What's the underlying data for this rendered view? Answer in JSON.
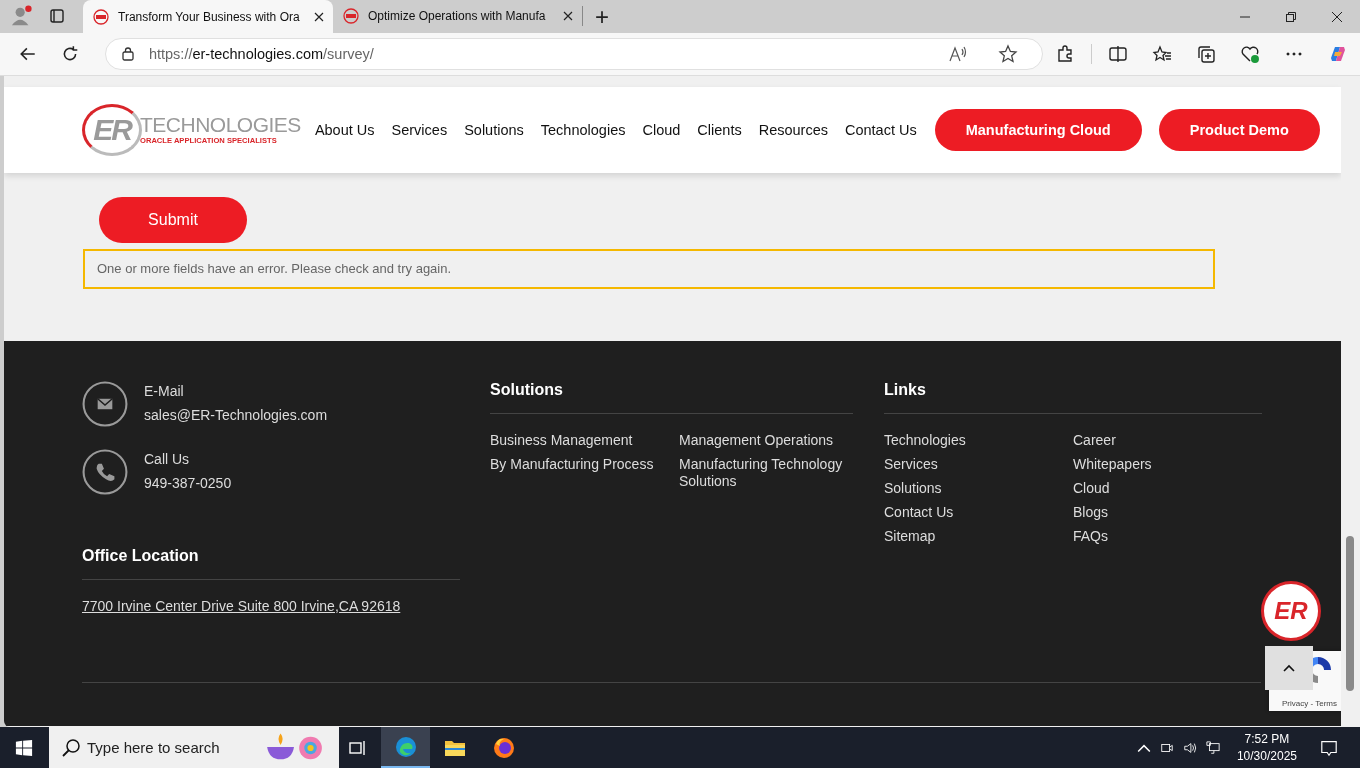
{
  "browser": {
    "tabs": [
      {
        "title": "Transform Your Business with Ora",
        "selected": true
      },
      {
        "title": "Optimize Operations with Manufa",
        "selected": false
      }
    ],
    "new_tab": "+",
    "url": {
      "scheme": "https://",
      "host": "er-technologies.com",
      "path": "/survey/"
    }
  },
  "header": {
    "logo": {
      "mark": "ER",
      "name": "TECHNOLOGIES",
      "tagline": "ORACLE APPLICATION SPECIALISTS"
    },
    "nav": [
      "About Us",
      "Services",
      "Solutions",
      "Technologies",
      "Cloud",
      "Clients",
      "Resources",
      "Contact Us"
    ],
    "buttons": [
      "Manufacturing Cloud",
      "Product Demo"
    ]
  },
  "form": {
    "submit": "Submit",
    "error": "One or more fields have an error. Please check and try again."
  },
  "footer": {
    "contacts": [
      {
        "kind": "mail",
        "label": "E-Mail",
        "value": "sales@ER-Technologies.com"
      },
      {
        "kind": "phone",
        "label": "Call Us",
        "value": "949-387-0250"
      }
    ],
    "office": {
      "title": "Office Location",
      "address": "7700 Irvine Center Drive Suite 800 Irvine,CA 92618"
    },
    "solutions": {
      "title": "Solutions",
      "columns": [
        [
          "Business Management",
          "By Manufacturing Process"
        ],
        [
          "Management Operations",
          "Manufacturing Technology Solutions"
        ]
      ]
    },
    "links": {
      "title": "Links",
      "columns": [
        [
          "Technologies",
          "Services",
          "Solutions",
          "Contact Us",
          "Sitemap"
        ],
        [
          "Career",
          "Whitepapers",
          "Cloud",
          "Blogs",
          "FAQs"
        ]
      ]
    }
  },
  "badge": {
    "mark": "ER"
  },
  "recaptcha": "Privacy - Terms",
  "taskbar": {
    "search": {
      "placeholder": "Type here to search"
    },
    "time": "7:52 PM",
    "date": "10/30/2025"
  }
}
